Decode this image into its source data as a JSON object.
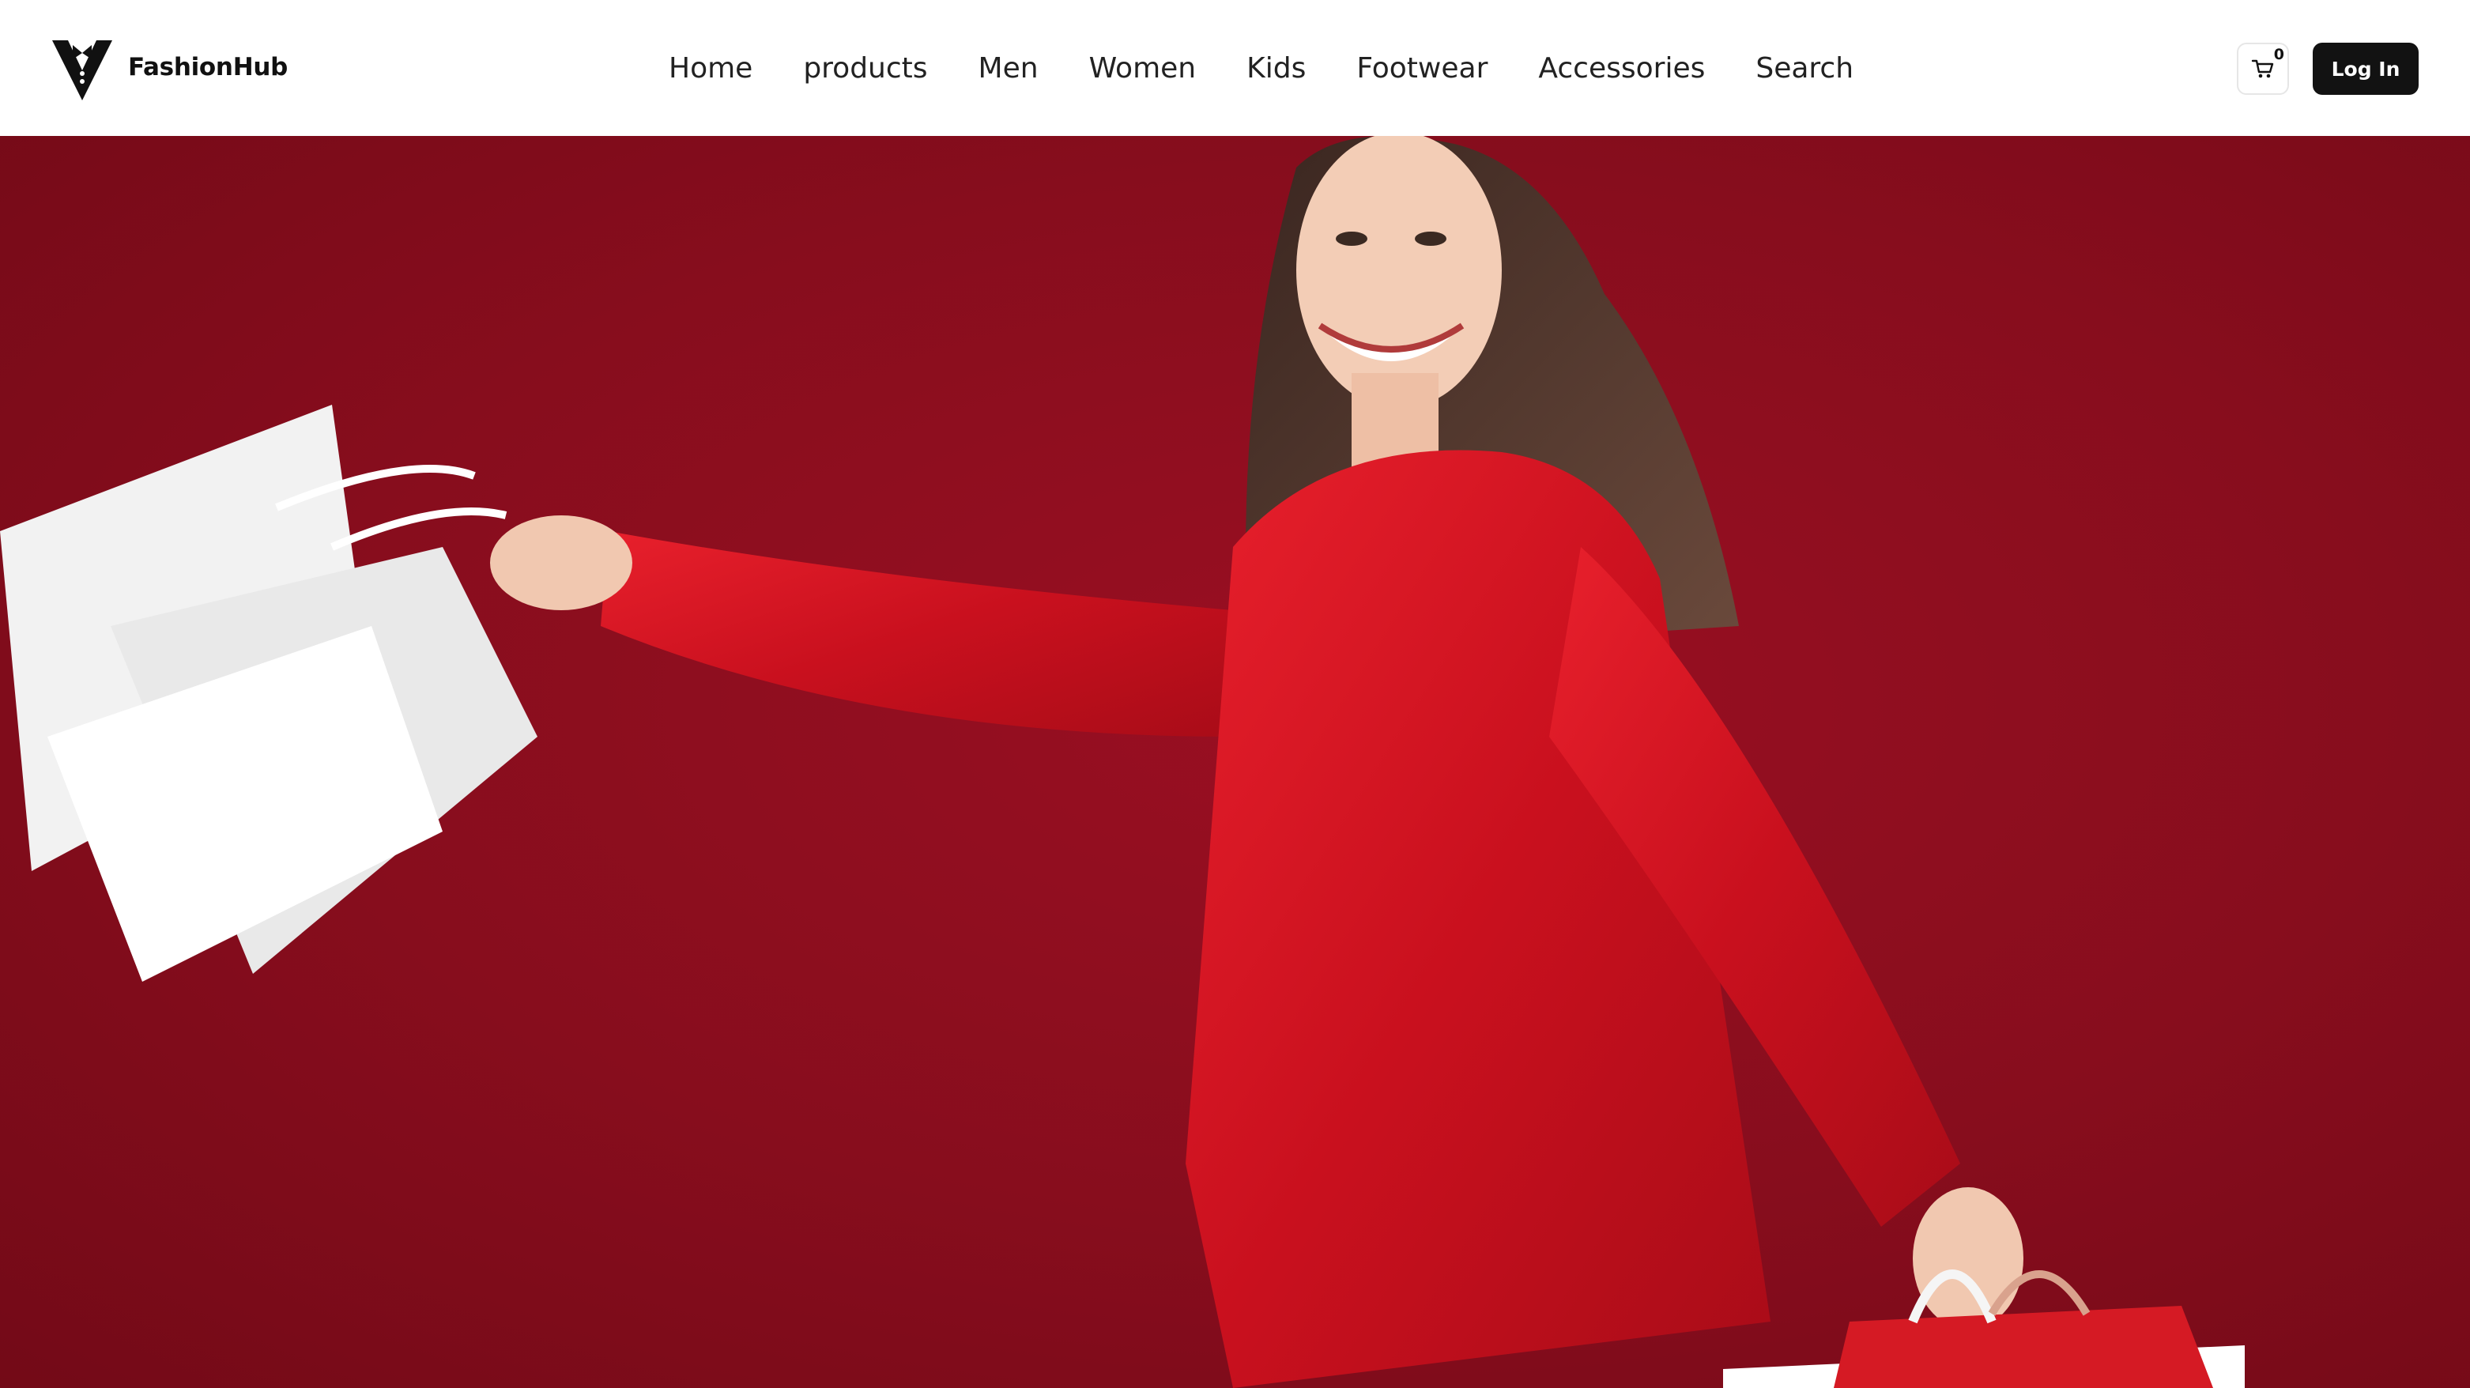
{
  "header": {
    "brand_name": "FashionHub",
    "nav": [
      "Home",
      "products",
      "Men",
      "Women",
      "Kids",
      "Footwear",
      "Accessories",
      "Search"
    ],
    "cart_count": "0",
    "login_label": "Log In"
  },
  "hero": {
    "background_color": "#870d1d",
    "image_subject": "woman-in-red-shirt-with-shopping-bags"
  },
  "icons": [
    "tuxedo-logo-icon",
    "shopping-cart-icon"
  ]
}
